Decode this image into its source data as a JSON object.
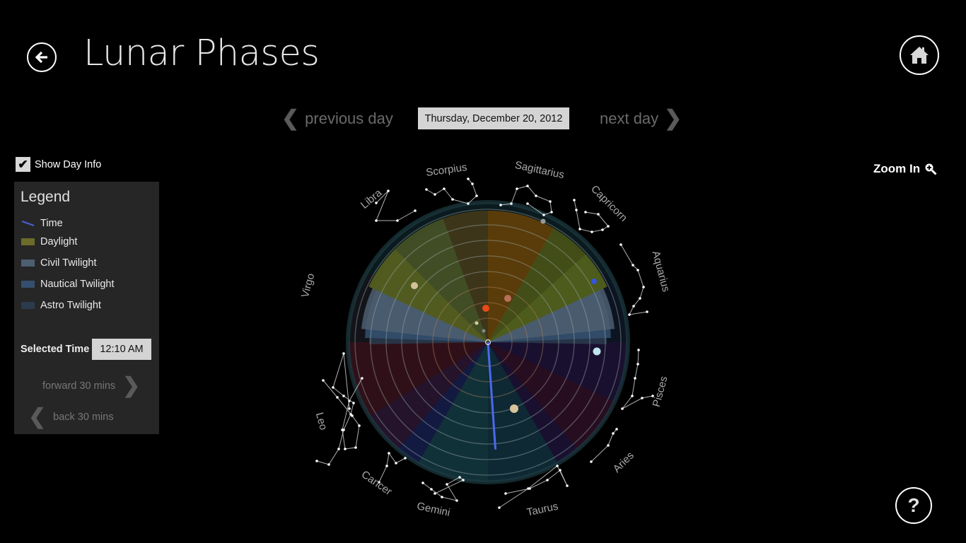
{
  "header": {
    "title": "Lunar Phases",
    "back_icon": "arrow-left-circle-icon",
    "home_icon": "home-icon",
    "help_icon": "question-mark-icon"
  },
  "day_nav": {
    "previous_label": "previous day",
    "next_label": "next day",
    "current_date": "Thursday, December 20, 2012"
  },
  "show_day_info": {
    "label": "Show Day Info",
    "checked": true
  },
  "legend": {
    "title": "Legend",
    "items": [
      {
        "label": "Time",
        "type": "line",
        "color": "#4a5fd0"
      },
      {
        "label": "Daylight",
        "type": "swatch",
        "color": "#6b6b2a"
      },
      {
        "label": "Civil Twilight",
        "type": "swatch",
        "color": "#4d5e70"
      },
      {
        "label": "Nautical Twilight",
        "type": "swatch",
        "color": "#34506e"
      },
      {
        "label": "Astro Twilight",
        "type": "swatch",
        "color": "#2b3a4d"
      }
    ],
    "selected_time_label": "Selected Time",
    "selected_time": "12:10 AM",
    "forward_label": "forward 30 mins",
    "back_label": "back 30 mins"
  },
  "zoom": {
    "label": "Zoom In",
    "icon": "zoom-in-icon"
  },
  "chart_data": {
    "type": "polar-sky-chart",
    "selected_time": "12:10 AM",
    "time_hand_angle_deg_from_top": 176,
    "orbit_ring_count": 8,
    "constellations": [
      "Scorpius",
      "Sagittarius",
      "Capricorn",
      "Aquarius",
      "Pisces",
      "Aries",
      "Taurus",
      "Gemini",
      "Cancer",
      "Leo",
      "Virgo",
      "Libra"
    ],
    "sectors": [
      {
        "name": "Daylight",
        "from_deg": -65,
        "to_deg": 65,
        "color": "#6b6b2a"
      },
      {
        "name": "Civil Twilight",
        "from_deg": -84,
        "to_deg": 84,
        "color": "#4d5e70"
      },
      {
        "name": "Nautical Twilight",
        "from_deg": -88,
        "to_deg": 88,
        "color": "#34506e"
      },
      {
        "name": "Astro Twilight",
        "from_deg": -91,
        "to_deg": 91,
        "color": "#2b3a4d"
      }
    ],
    "bodies": [
      {
        "name": "Sun",
        "color": "#e84a1a"
      },
      {
        "name": "Mercury",
        "color": "#cfcf9f"
      },
      {
        "name": "Venus",
        "color": "#888"
      },
      {
        "name": "Mars",
        "color": "#b8705a"
      },
      {
        "name": "Jupiter",
        "color": "#d8c49a"
      },
      {
        "name": "Saturn",
        "color": "#d2c09a"
      },
      {
        "name": "Uranus",
        "color": "#bfe4ec"
      },
      {
        "name": "Neptune",
        "color": "#3355dd"
      },
      {
        "name": "Pluto",
        "color": "#999999"
      }
    ]
  }
}
